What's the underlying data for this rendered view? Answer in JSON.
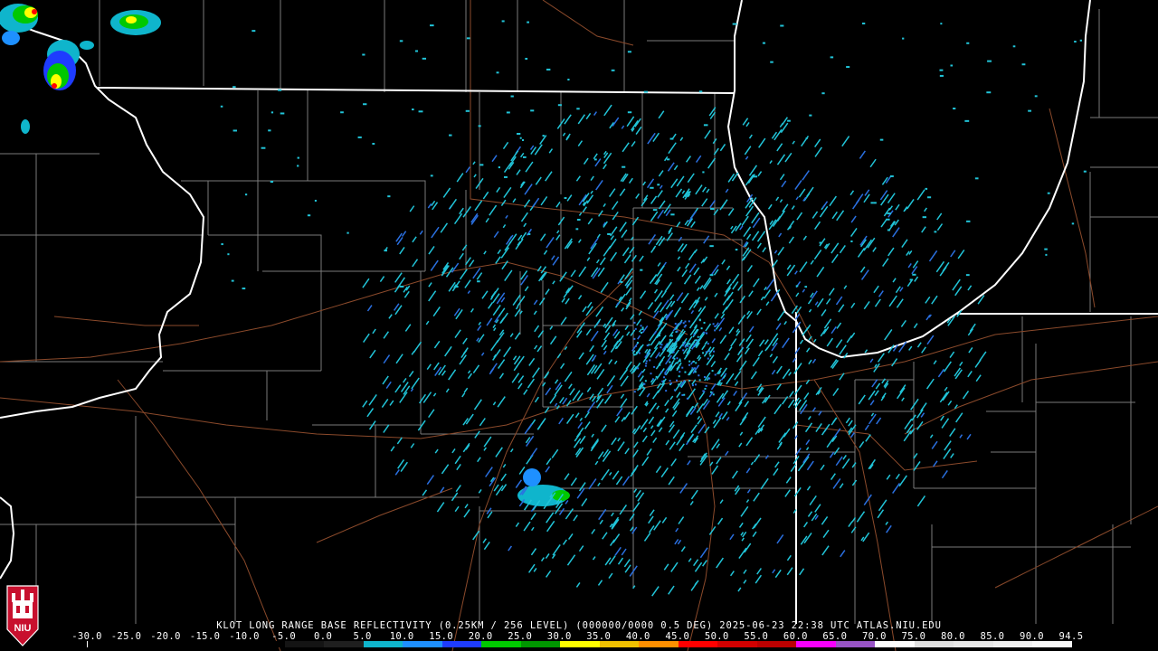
{
  "title": "KLOT LONG RANGE BASE REFLECTIVITY (0.25KM / 256 LEVEL) (000000/0000 0.5 DEG) 2025-06-23 22:38 UTC  ATLAS.NIU.EDU",
  "logo_text": "NIU",
  "colors": {
    "background": "#000000",
    "state_border": "#ffffff",
    "county_border": "#808080",
    "highway": "#8b4a2b",
    "clutter_cyan": "#21c4d8",
    "clutter_blue": "#2a6fe0"
  },
  "colorbar": {
    "labels": [
      "-30.0",
      "-25.0",
      "-20.0",
      "-15.0",
      "-10.0",
      "-5.0",
      "0.0",
      "5.0",
      "10.0",
      "15.0",
      "20.0",
      "25.0",
      "30.0",
      "35.0",
      "40.0",
      "45.0",
      "50.0",
      "55.0",
      "60.0",
      "65.0",
      "70.0",
      "75.0",
      "80.0",
      "85.0",
      "90.0",
      "94.5"
    ],
    "colors": [
      "#000000",
      "#000000",
      "#000000",
      "#000000",
      "#000000",
      "#141414",
      "#1f1f1f",
      "#0fb5cc",
      "#1e90ff",
      "#1e3cff",
      "#00c800",
      "#009600",
      "#ffff00",
      "#f0c000",
      "#ff9000",
      "#ff0000",
      "#d40000",
      "#bc0000",
      "#f800fd",
      "#9854c6",
      "#fdfdfd",
      "#e0e0e0",
      "#e8e8e8",
      "#f0f0f0",
      "#f8f8f8"
    ]
  }
}
